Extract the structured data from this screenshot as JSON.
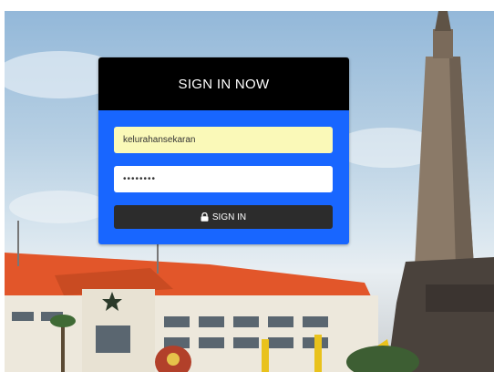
{
  "login": {
    "title": "SIGN IN NOW",
    "username_value": "kelurahansekaran",
    "password_value": "••••••••",
    "signin_label": "SIGN IN",
    "signin_icon": "lock-icon"
  },
  "colors": {
    "header_bg": "#000000",
    "body_bg": "#1866ff",
    "username_bg": "#faf9b8",
    "button_bg": "#2c2c2c"
  }
}
